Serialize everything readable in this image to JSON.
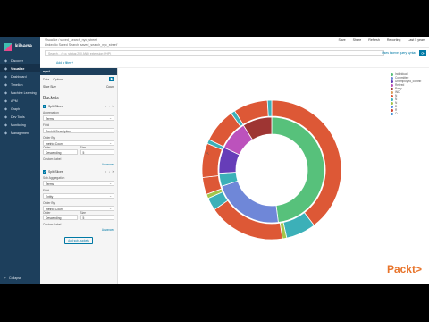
{
  "sidebar": {
    "logo_text": "kibana",
    "items": [
      {
        "label": "Discover",
        "icon": "compass-icon"
      },
      {
        "label": "Visualize",
        "icon": "chart-icon",
        "active": true
      },
      {
        "label": "Dashboard",
        "icon": "dashboard-icon"
      },
      {
        "label": "Timelion",
        "icon": "timelion-icon"
      },
      {
        "label": "Machine Learning",
        "icon": "ml-icon"
      },
      {
        "label": "APM",
        "icon": "apm-icon"
      },
      {
        "label": "Graph",
        "icon": "graph-icon"
      },
      {
        "label": "Dev Tools",
        "icon": "wrench-icon"
      },
      {
        "label": "Monitoring",
        "icon": "heartbeat-icon"
      },
      {
        "label": "Management",
        "icon": "gear-icon"
      }
    ],
    "collapse_label": "Collapse"
  },
  "topbar": {
    "breadcrumb": "Visualize / saved_search_nyc_street",
    "linked": "Linked to Saved Search 'saved_search_nyc_street'",
    "actions": [
      "Save",
      "Share",
      "Refresh",
      "Reporting",
      "Last 5 years"
    ]
  },
  "search": {
    "placeholder": "Search... (e.g. status:200 AND extension:PHP)",
    "hint": "Uses lucene query syntax"
  },
  "filter": {
    "add_label": "Add a filter +"
  },
  "editor": {
    "index_pattern": "nyc*",
    "tabs": [
      "Data",
      "Options"
    ],
    "metrics_row": {
      "label": "Slice Size",
      "action": "Count"
    },
    "buckets_title": "Buckets",
    "bucket1": {
      "header": "Split Slices",
      "aggregation_label": "Aggregation",
      "aggregation_value": "Terms",
      "field_label": "Field",
      "field_value": "Contrib Description",
      "orderby_label": "Order By",
      "orderby_value": "metric: Count",
      "order_label": "Order",
      "order_value": "Descending",
      "size_label": "Size",
      "size_value": "5",
      "custom_label": "Custom Label"
    },
    "advanced_label": "Advanced",
    "bucket2": {
      "header": "Split Slices",
      "aggregation_label": "Sub Aggregation",
      "aggregation_value": "Terms",
      "field_label": "Field",
      "field_value": "Entity",
      "orderby_label": "Order By",
      "orderby_value": "metric: Count",
      "order_label": "Order",
      "order_value": "Descending",
      "size_label": "Size",
      "size_value": "5",
      "custom_label": "Custom Label"
    },
    "add_sub_label": "Add sub-buckets"
  },
  "legend": [
    {
      "label": "Individual",
      "color": "#57c17b"
    },
    {
      "label": "Committee",
      "color": "#6f87d8"
    },
    {
      "label": "Unemployed_contrib",
      "color": "#663db8"
    },
    {
      "label": "Retired",
      "color": "#bc52bc"
    },
    {
      "label": "Party",
      "color": "#9e3533"
    },
    {
      "label": "IND",
      "color": "#daa05d"
    },
    {
      "label": "N",
      "color": "#dd5836"
    },
    {
      "label": "N",
      "color": "#3cb0b8"
    },
    {
      "label": "N",
      "color": "#a3c54a"
    },
    {
      "label": "D",
      "color": "#5b8de3"
    },
    {
      "label": "R",
      "color": "#cc4434"
    },
    {
      "label": "O",
      "color": "#3f8fd4"
    }
  ],
  "brand": {
    "text": "Packt",
    "mark": ">"
  },
  "chart_data": {
    "type": "pie",
    "inner": [
      {
        "label": "Individual",
        "value": 48,
        "color": "#57c17b"
      },
      {
        "label": "Committee",
        "value": 22,
        "color": "#6f87d8"
      },
      {
        "label": "Unemployed_contrib",
        "value": 4,
        "color": "#3cb0b8"
      },
      {
        "label": "Retired",
        "value": 8,
        "color": "#663db8"
      },
      {
        "label": "Party",
        "value": 9,
        "color": "#bc52bc"
      },
      {
        "label": "Other",
        "value": 9,
        "color": "#9e3533"
      }
    ],
    "outer": [
      {
        "value": 40,
        "color": "#dd5836"
      },
      {
        "value": 7,
        "color": "#3cb0b8"
      },
      {
        "value": 1,
        "color": "#a3c54a"
      },
      {
        "value": 18,
        "color": "#dd5836"
      },
      {
        "value": 3,
        "color": "#3cb0b8"
      },
      {
        "value": 1,
        "color": "#a3c54a"
      },
      {
        "value": 4,
        "color": "#dd5836"
      },
      {
        "value": 8,
        "color": "#dd5836"
      },
      {
        "value": 1,
        "color": "#3cb0b8"
      },
      {
        "value": 8,
        "color": "#dd5836"
      },
      {
        "value": 1,
        "color": "#3cb0b8"
      },
      {
        "value": 8,
        "color": "#dd5836"
      },
      {
        "value": 1,
        "color": "#3cb0b8"
      }
    ]
  }
}
